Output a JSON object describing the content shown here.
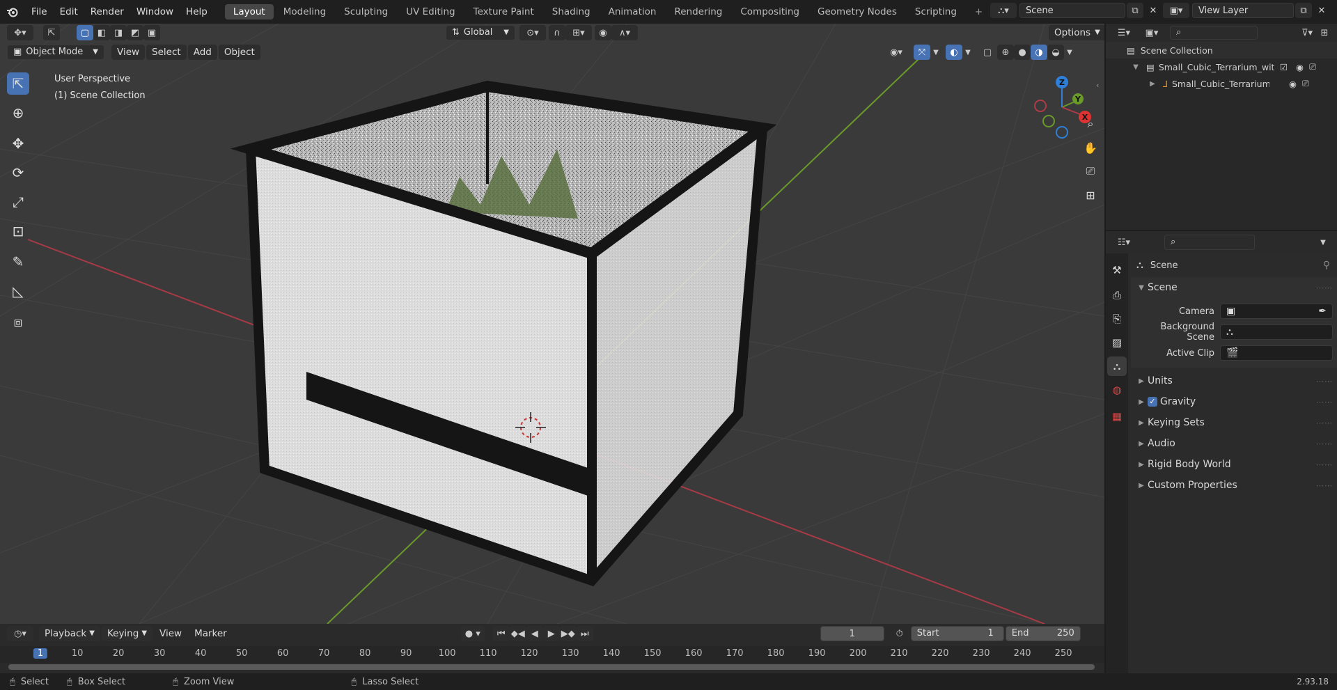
{
  "topbar": {
    "menus": [
      "File",
      "Edit",
      "Render",
      "Window",
      "Help"
    ],
    "workspaces": [
      "Layout",
      "Modeling",
      "Sculpting",
      "UV Editing",
      "Texture Paint",
      "Shading",
      "Animation",
      "Rendering",
      "Compositing",
      "Geometry Nodes",
      "Scripting"
    ],
    "active_workspace": "Layout",
    "scene_name": "Scene",
    "view_layer": "View Layer"
  },
  "viewport_header": {
    "mode": "Object Mode",
    "menus": [
      "View",
      "Select",
      "Add",
      "Object"
    ],
    "orientation": "Global",
    "options": "Options"
  },
  "viewport": {
    "perspective": "User Perspective",
    "collection": "(1) Scene Collection",
    "gizmo": {
      "x": "X",
      "y": "Y",
      "z": "Z"
    }
  },
  "outliner": {
    "root": "Scene Collection",
    "items": [
      {
        "label": "Small_Cubic_Terrarium_with_l"
      },
      {
        "label": "Small_Cubic_Terrarium_w"
      }
    ]
  },
  "properties": {
    "context": "Scene",
    "panel": "Scene",
    "fields": [
      {
        "label": "Camera"
      },
      {
        "label": "Background Scene"
      },
      {
        "label": "Active Clip"
      }
    ],
    "sections": [
      {
        "label": "Units"
      },
      {
        "label": "Gravity",
        "checked": true
      },
      {
        "label": "Keying Sets"
      },
      {
        "label": "Audio"
      },
      {
        "label": "Rigid Body World"
      },
      {
        "label": "Custom Properties"
      }
    ]
  },
  "timeline": {
    "menus": [
      "Playback",
      "Keying",
      "View",
      "Marker"
    ],
    "current_frame": "1",
    "start_label": "Start",
    "start": "1",
    "end_label": "End",
    "end": "250",
    "ticks": [
      "1",
      "10",
      "20",
      "30",
      "40",
      "50",
      "60",
      "70",
      "80",
      "90",
      "100",
      "110",
      "120",
      "130",
      "140",
      "150",
      "160",
      "170",
      "180",
      "190",
      "200",
      "210",
      "220",
      "230",
      "240",
      "250"
    ]
  },
  "statusbar": {
    "select": "Select",
    "box_select": "Box Select",
    "zoom_view": "Zoom View",
    "lasso_select": "Lasso Select",
    "version": "2.93.18"
  },
  "colors": {
    "accent": "#4772b3",
    "x_axis": "#b03a48",
    "y_axis": "#6a9a2a",
    "z_axis": "#2f7fd8"
  }
}
